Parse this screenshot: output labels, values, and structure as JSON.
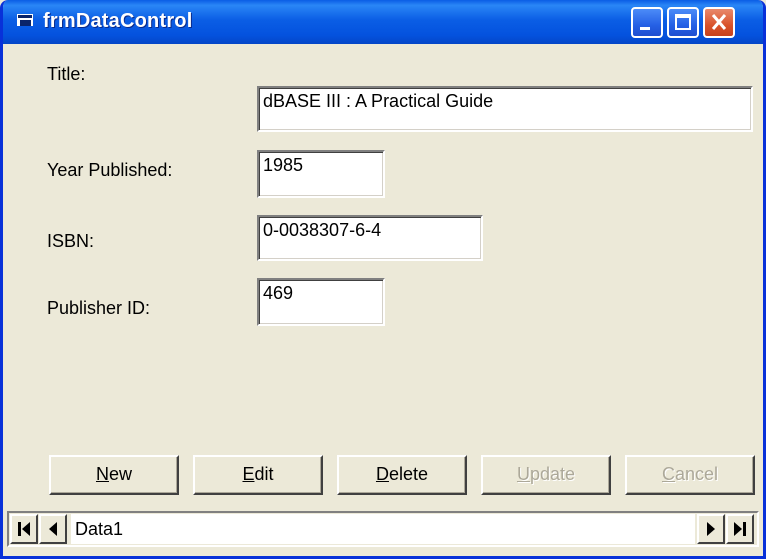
{
  "window": {
    "title": "frmDataControl"
  },
  "form": {
    "title_label": "Title:",
    "title_value": "dBASE III : A Practical Guide",
    "year_label": "Year Published:",
    "year_value": "1985",
    "isbn_label": "ISBN:",
    "isbn_value": "0-0038307-6-4",
    "publisher_label": "Publisher ID:",
    "publisher_value": "469"
  },
  "buttons": {
    "new": {
      "mnemonic": "N",
      "rest": "ew",
      "enabled": true
    },
    "edit": {
      "mnemonic": "E",
      "rest": "dit",
      "enabled": true
    },
    "delete": {
      "mnemonic": "D",
      "rest": "elete",
      "enabled": true
    },
    "update": {
      "mnemonic": "U",
      "rest": "pdate",
      "enabled": false
    },
    "cancel": {
      "mnemonic": "C",
      "rest": "ancel",
      "enabled": false
    }
  },
  "data_control": {
    "caption": "Data1"
  },
  "icons": [
    "app-icon",
    "minimize-icon",
    "maximize-icon",
    "close-icon",
    "first-record-icon",
    "previous-record-icon",
    "next-record-icon",
    "last-record-icon"
  ],
  "colors": {
    "titlebar": "#0b5ee5",
    "close": "#d9532b",
    "face": "#ece9d8"
  }
}
